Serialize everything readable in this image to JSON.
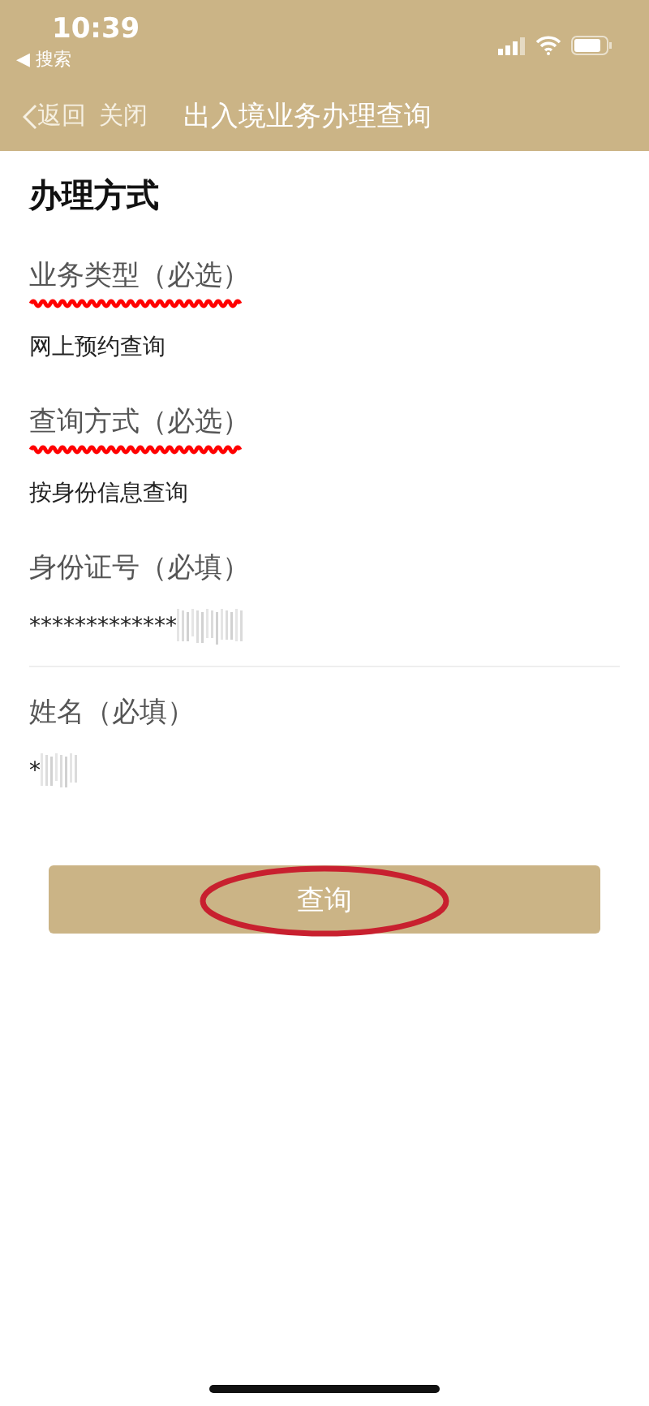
{
  "status_bar": {
    "time": "10:39",
    "back_app": {
      "arrow": "◀",
      "label": "搜索"
    }
  },
  "nav": {
    "back": "返回",
    "close": "关闭",
    "title": "出入境业务办理查询"
  },
  "section": {
    "heading": "办理方式"
  },
  "fields": [
    {
      "label": "业务类型（必选）",
      "value": "网上预约查询",
      "underlined": true,
      "redacted": false,
      "divider": false
    },
    {
      "label": "查询方式（必选）",
      "value": "按身份信息查询",
      "underlined": true,
      "redacted": false,
      "divider": false
    },
    {
      "label": "身份证号（必填）",
      "value": "*************",
      "underlined": false,
      "redacted": true,
      "divider": true
    },
    {
      "label": "姓名（必填）",
      "value": "*",
      "underlined": false,
      "redacted": true,
      "divider": false
    }
  ],
  "submit": {
    "label": "查询",
    "circled": true
  }
}
